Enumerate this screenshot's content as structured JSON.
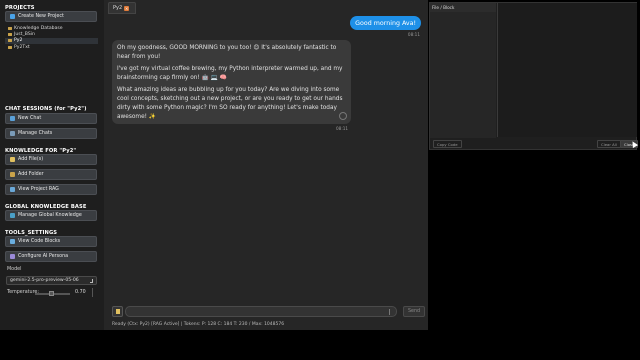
{
  "sidebar": {
    "projects_title": "PROJECTS",
    "create_project_label": "Create New Project",
    "tree": [
      {
        "label": "Knowledge Database",
        "selected": false
      },
      {
        "label": "Just_BSin",
        "selected": false
      },
      {
        "label": "Py2",
        "selected": true
      },
      {
        "label": "Py2Txt",
        "selected": false
      }
    ],
    "chat_sessions_title": "CHAT SESSIONS (for \"Py2\")",
    "new_chat_label": "New Chat",
    "manage_chats_label": "Manage Chats",
    "knowledge_title": "KNOWLEDGE FOR \"Py2\"",
    "add_files_label": "Add File(s)",
    "add_folder_label": "Add Folder",
    "view_rag_label": "View Project RAG",
    "global_kb_title": "GLOBAL KNOWLEDGE BASE",
    "manage_global_label": "Manage Global Knowledge",
    "tools_title": "TOOLS_SETTINGS",
    "view_code_label": "View Code Blocks",
    "configure_persona_label": "Configure AI Persona",
    "model_label": "Model",
    "model_value": "gemini-2.5-pro-preview-05-06",
    "temperature_label": "Temperature:",
    "temperature_value": "0.70"
  },
  "chat": {
    "tab_label": "Py2",
    "user_message": "Good morning Ava!",
    "user_time": "08:11",
    "ai_paragraphs": [
      "Oh my goodness, GOOD MORNING to you too! 😊 It's absolutely fantastic to hear from you!",
      "I've got my virtual coffee brewing, my Python interpreter warmed up, and my brainstorming cap firmly on! 🤖 💻 🧠",
      "What amazing ideas are bubbling up for you today? Are we diving into some cool concepts, sketching out a new project, or are you ready to get our hands dirty with some Python magic? I'm SO ready for anything! Let's make today awesome! ✨"
    ],
    "ai_time": "08:11",
    "send_label": "Send",
    "status_text": "Ready (Ctx: Py2) [RAG Active] | Tokens: P: 128 C: 184 T: 230 / Max: 1048576"
  },
  "code_panel": {
    "header": "File / Block",
    "copy_code_label": "Copy Code",
    "clear_all_label": "Clear All",
    "close_label": "Close"
  },
  "colors": {
    "accent_blue": "#1e90e8",
    "sidebar_bg": "#1e1e1e",
    "chat_bg": "#262626"
  }
}
